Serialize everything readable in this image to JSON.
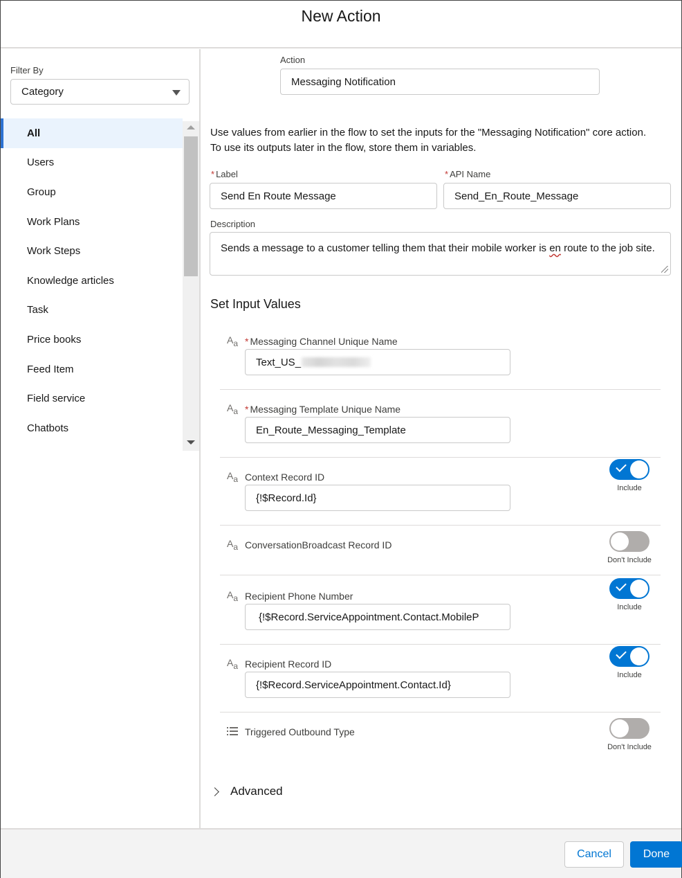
{
  "modal": {
    "title": "New Action"
  },
  "sidebar": {
    "filter_label": "Filter By",
    "filter_value": "Category",
    "categories": [
      {
        "label": "All",
        "active": true
      },
      {
        "label": "Users"
      },
      {
        "label": "Group"
      },
      {
        "label": "Work Plans"
      },
      {
        "label": "Work Steps"
      },
      {
        "label": "Knowledge articles"
      },
      {
        "label": "Task"
      },
      {
        "label": "Price books"
      },
      {
        "label": "Feed Item"
      },
      {
        "label": "Field service"
      },
      {
        "label": "Chatbots"
      }
    ]
  },
  "main": {
    "action_label": "Action",
    "action_value": "Messaging Notification",
    "help_line1": "Use values from earlier in the flow to set the inputs for the \"Messaging Notification\" core action.",
    "help_line2": "To use its outputs later in the flow, store them in variables.",
    "label_label": "Label",
    "label_value": "Send En Route Message",
    "api_name_label": "API Name",
    "api_name_value": "Send_En_Route_Message",
    "required_marker": "*",
    "description_label": "Description",
    "description_before": "Sends a message to a customer telling them that their mobile worker is ",
    "description_spell": "en",
    "description_after": " route to the job site.",
    "section_title": "Set Input Values",
    "params": [
      {
        "label": "Messaging Channel Unique Name",
        "required": true,
        "value": "Text_US_",
        "value_redacted": true,
        "icon": "text-type-icon"
      },
      {
        "label": "Messaging Template Unique Name",
        "required": true,
        "value": "En_Route_Messaging_Template",
        "icon": "text-type-icon"
      },
      {
        "label": "Context Record ID",
        "value": "{!$Record.Id}",
        "toggle": "on",
        "toggle_text": "Include",
        "icon": "text-type-icon"
      },
      {
        "label": "ConversationBroadcast Record ID",
        "toggle": "off",
        "toggle_text": "Don't Include",
        "icon": "text-type-icon"
      },
      {
        "label": "Recipient Phone Number",
        "value": "{!$Record.ServiceAppointment.Contact.MobileP",
        "toggle": "on",
        "toggle_text": "Include",
        "icon": "text-type-icon"
      },
      {
        "label": "Recipient Record ID",
        "value": "{!$Record.ServiceAppointment.Contact.Id}",
        "toggle": "on",
        "toggle_text": "Include",
        "icon": "text-type-icon"
      },
      {
        "label": "Triggered Outbound Type",
        "toggle": "off",
        "toggle_text": "Don't Include",
        "icon": "picklist-icon"
      }
    ],
    "type_icon_big": "A",
    "type_icon_small": "a",
    "advanced_label": "Advanced"
  },
  "footer": {
    "cancel_label": "Cancel",
    "done_label": "Done"
  },
  "colors": {
    "brand": "#0176d3",
    "required": "#c23934",
    "active_bg": "#eaf3fd",
    "toggle_off": "#b0adab"
  }
}
